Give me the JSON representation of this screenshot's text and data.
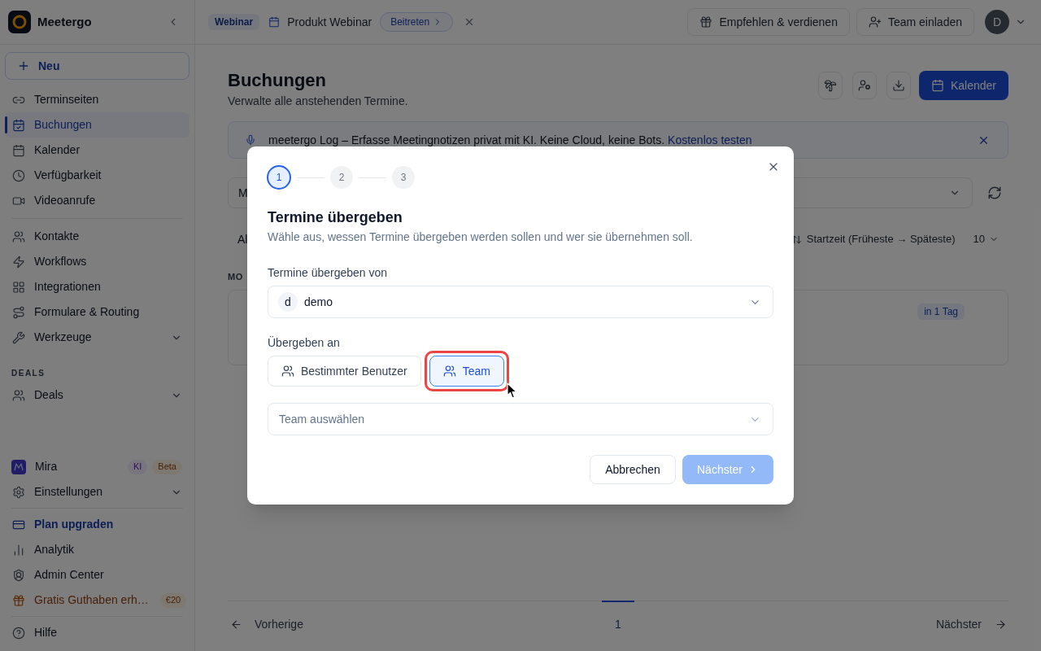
{
  "sidebar": {
    "brand": "Meetergo",
    "new_button": "Neu",
    "sections": [
      {
        "items": [
          {
            "label": "Terminseiten",
            "kind": "nav",
            "selected": false,
            "expandable": false
          },
          {
            "label": "Buchungen",
            "kind": "nav",
            "selected": true,
            "expandable": false
          },
          {
            "label": "Kalender",
            "kind": "nav",
            "selected": false,
            "expandable": false
          },
          {
            "label": "Verfügbarkeit",
            "kind": "nav",
            "selected": false,
            "expandable": false
          },
          {
            "label": "Videoanrufe",
            "kind": "nav",
            "selected": false,
            "expandable": false
          }
        ]
      },
      {
        "items": [
          {
            "label": "Kontakte",
            "kind": "nav",
            "selected": false,
            "expandable": false
          },
          {
            "label": "Workflows",
            "kind": "nav",
            "selected": false,
            "expandable": false
          },
          {
            "label": "Integrationen",
            "kind": "nav",
            "selected": false,
            "expandable": false
          },
          {
            "label": "Formulare & Routing",
            "kind": "nav",
            "selected": false,
            "expandable": false
          },
          {
            "label": "Werkzeuge",
            "kind": "nav",
            "selected": false,
            "expandable": true
          }
        ]
      },
      {
        "heading": "DEALS",
        "items": [
          {
            "label": "Deals",
            "kind": "nav",
            "selected": false,
            "expandable": true
          }
        ]
      }
    ],
    "bottom_sections": [
      {
        "items": [
          {
            "label": "Mira",
            "kind": "nav",
            "selected": false,
            "expandable": false,
            "badges": [
              {
                "text": "KI",
                "kind": "ai"
              },
              {
                "text": "Beta",
                "kind": "beta"
              }
            ]
          },
          {
            "label": "Einstellungen",
            "kind": "nav",
            "selected": false,
            "expandable": true
          }
        ]
      },
      {
        "items": [
          {
            "label": "Plan upgraden",
            "kind": "upgrade",
            "selected": false,
            "expandable": false
          },
          {
            "label": "Analytik",
            "kind": "nav",
            "selected": false,
            "expandable": false
          },
          {
            "label": "Admin Center",
            "kind": "nav",
            "selected": false,
            "expandable": false
          },
          {
            "label": "Gratis Guthaben erh…",
            "kind": "promo",
            "selected": false,
            "expandable": false,
            "badges": [
              {
                "text": "€20",
                "kind": "reward"
              }
            ]
          }
        ]
      },
      {
        "items": [
          {
            "label": "Hilfe",
            "kind": "nav",
            "selected": false,
            "expandable": false
          }
        ]
      }
    ]
  },
  "top_bar": {
    "event_type": "Webinar",
    "event_title": "Produkt Webinar",
    "join_button": "Beitreten",
    "actions": [
      "Empfehlen & verdienen",
      "Team einladen"
    ],
    "avatar": "D"
  },
  "page": {
    "title": "Buchungen",
    "subtitle": "Verwalte alle anstehenden Termine.",
    "calendar_button": "Kalender",
    "banner": {
      "text": "meetergo Log – Erfasse Meetingnotizen privat mit KI. Keine Cloud, keine Bots.",
      "link": "Kostenlos testen"
    },
    "filter_select": {
      "value": "M"
    },
    "view_filter": "Al",
    "sort": "Startzeit (Früheste → Späteste)",
    "page_size": "10",
    "group_heading": "MO",
    "booking_card": {
      "badge": "in 1 Tag"
    },
    "pagination": {
      "previous": "Vorherige",
      "pages": [
        {
          "label": "1",
          "selected": true
        }
      ],
      "next": "Nächster"
    }
  },
  "dialog": {
    "steps": [
      {
        "label": "1",
        "selected": true
      },
      {
        "label": "2",
        "selected": false
      },
      {
        "label": "3",
        "selected": false
      }
    ],
    "title": "Termine übergeben",
    "description": "Wähle aus, wessen Termine übergeben werden sollen und wer sie übernehmen soll.",
    "from": {
      "label": "Termine übergeben von",
      "avatar": "d",
      "value": "demo"
    },
    "to": {
      "label": "Übergeben an",
      "options": [
        {
          "label": "Bestimmter Benutzer",
          "selected": false,
          "highlighted": false
        },
        {
          "label": "Team",
          "selected": true,
          "highlighted": true
        }
      ]
    },
    "team_select": {
      "placeholder": "Team auswählen"
    },
    "buttons": [
      {
        "label": "Abbrechen",
        "kind": "secondary",
        "disabled": false
      },
      {
        "label": "Nächster",
        "kind": "primary",
        "disabled": true
      }
    ]
  }
}
